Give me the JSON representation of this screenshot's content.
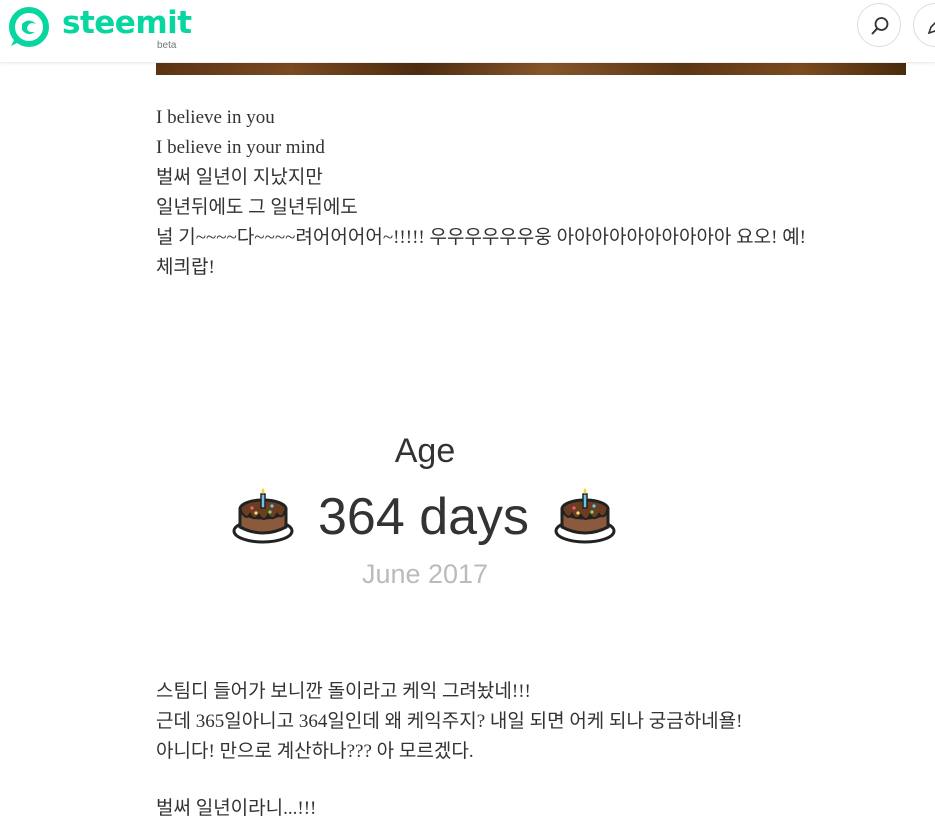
{
  "header": {
    "brand": "steemit",
    "badge": "beta",
    "search_icon": "search-icon",
    "write_icon": "pencil-icon",
    "accent_color": "#07d6a0"
  },
  "post": {
    "para1": [
      "I believe in you",
      "I believe in your mind",
      "벌써 일년이 지났지만",
      "일년뒤에도 그 일년뒤에도",
      "널 기~~~~다~~~~려어어어어~!!!!! 우우우우우우웅 아아아아아아아아아아 요오! 예!",
      "체킈랍!"
    ],
    "age_widget": {
      "label": "Age",
      "value": "364 days",
      "date": "June 2017",
      "icon": "birthday-cake-icon"
    },
    "para2": [
      "스팀디 들어가 보니깐 돌이라고 케익 그려놨네!!!",
      "근데 365일아니고 364일인데 왜 케익주지? 내일 되면 어케 되나 궁금하네욜!",
      "아니다! 만으로 계산하나??? 아 모르겠다."
    ],
    "para3": "벌써 일년이라니...!!!"
  }
}
